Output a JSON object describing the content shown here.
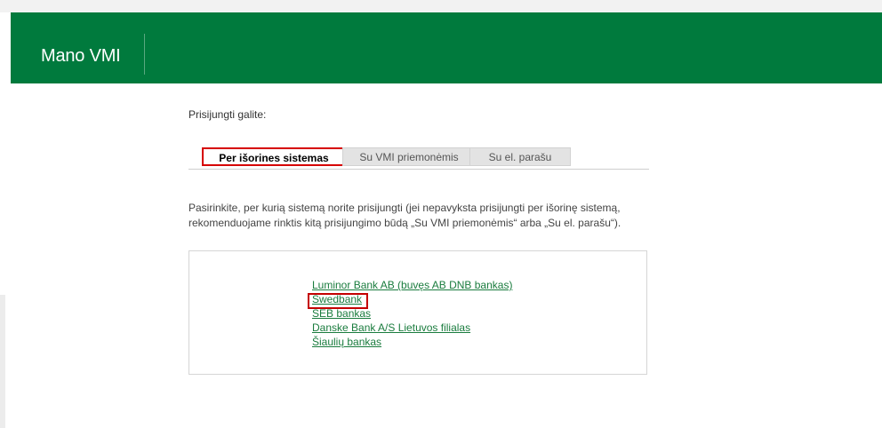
{
  "header": {
    "title": "Mano VMI"
  },
  "intro": "Prisijungti galite:",
  "tabs": [
    {
      "label": "Per išorines sistemas"
    },
    {
      "label": "Su VMI priemonėmis"
    },
    {
      "label": "Su el. parašu"
    }
  ],
  "description": "Pasirinkite, per kurią sistemą norite prisijungti (jei nepavyksta prisijungti per išorinę sistemą, rekomenduojame rinktis kitą prisijungimo būdą „Su VMI priemonėmis“ arba „Su el. parašu“).",
  "banks": [
    {
      "label": "Luminor Bank AB (buvęs AB DNB bankas)"
    },
    {
      "label": "Swedbank"
    },
    {
      "label": "SEB bankas"
    },
    {
      "label": "Danske Bank A/S Lietuvos filialas"
    },
    {
      "label": "Šiaulių bankas"
    }
  ],
  "colors": {
    "brand_green": "#007a3d",
    "link_green": "#1a7c3e",
    "highlight_red": "#c40000"
  }
}
